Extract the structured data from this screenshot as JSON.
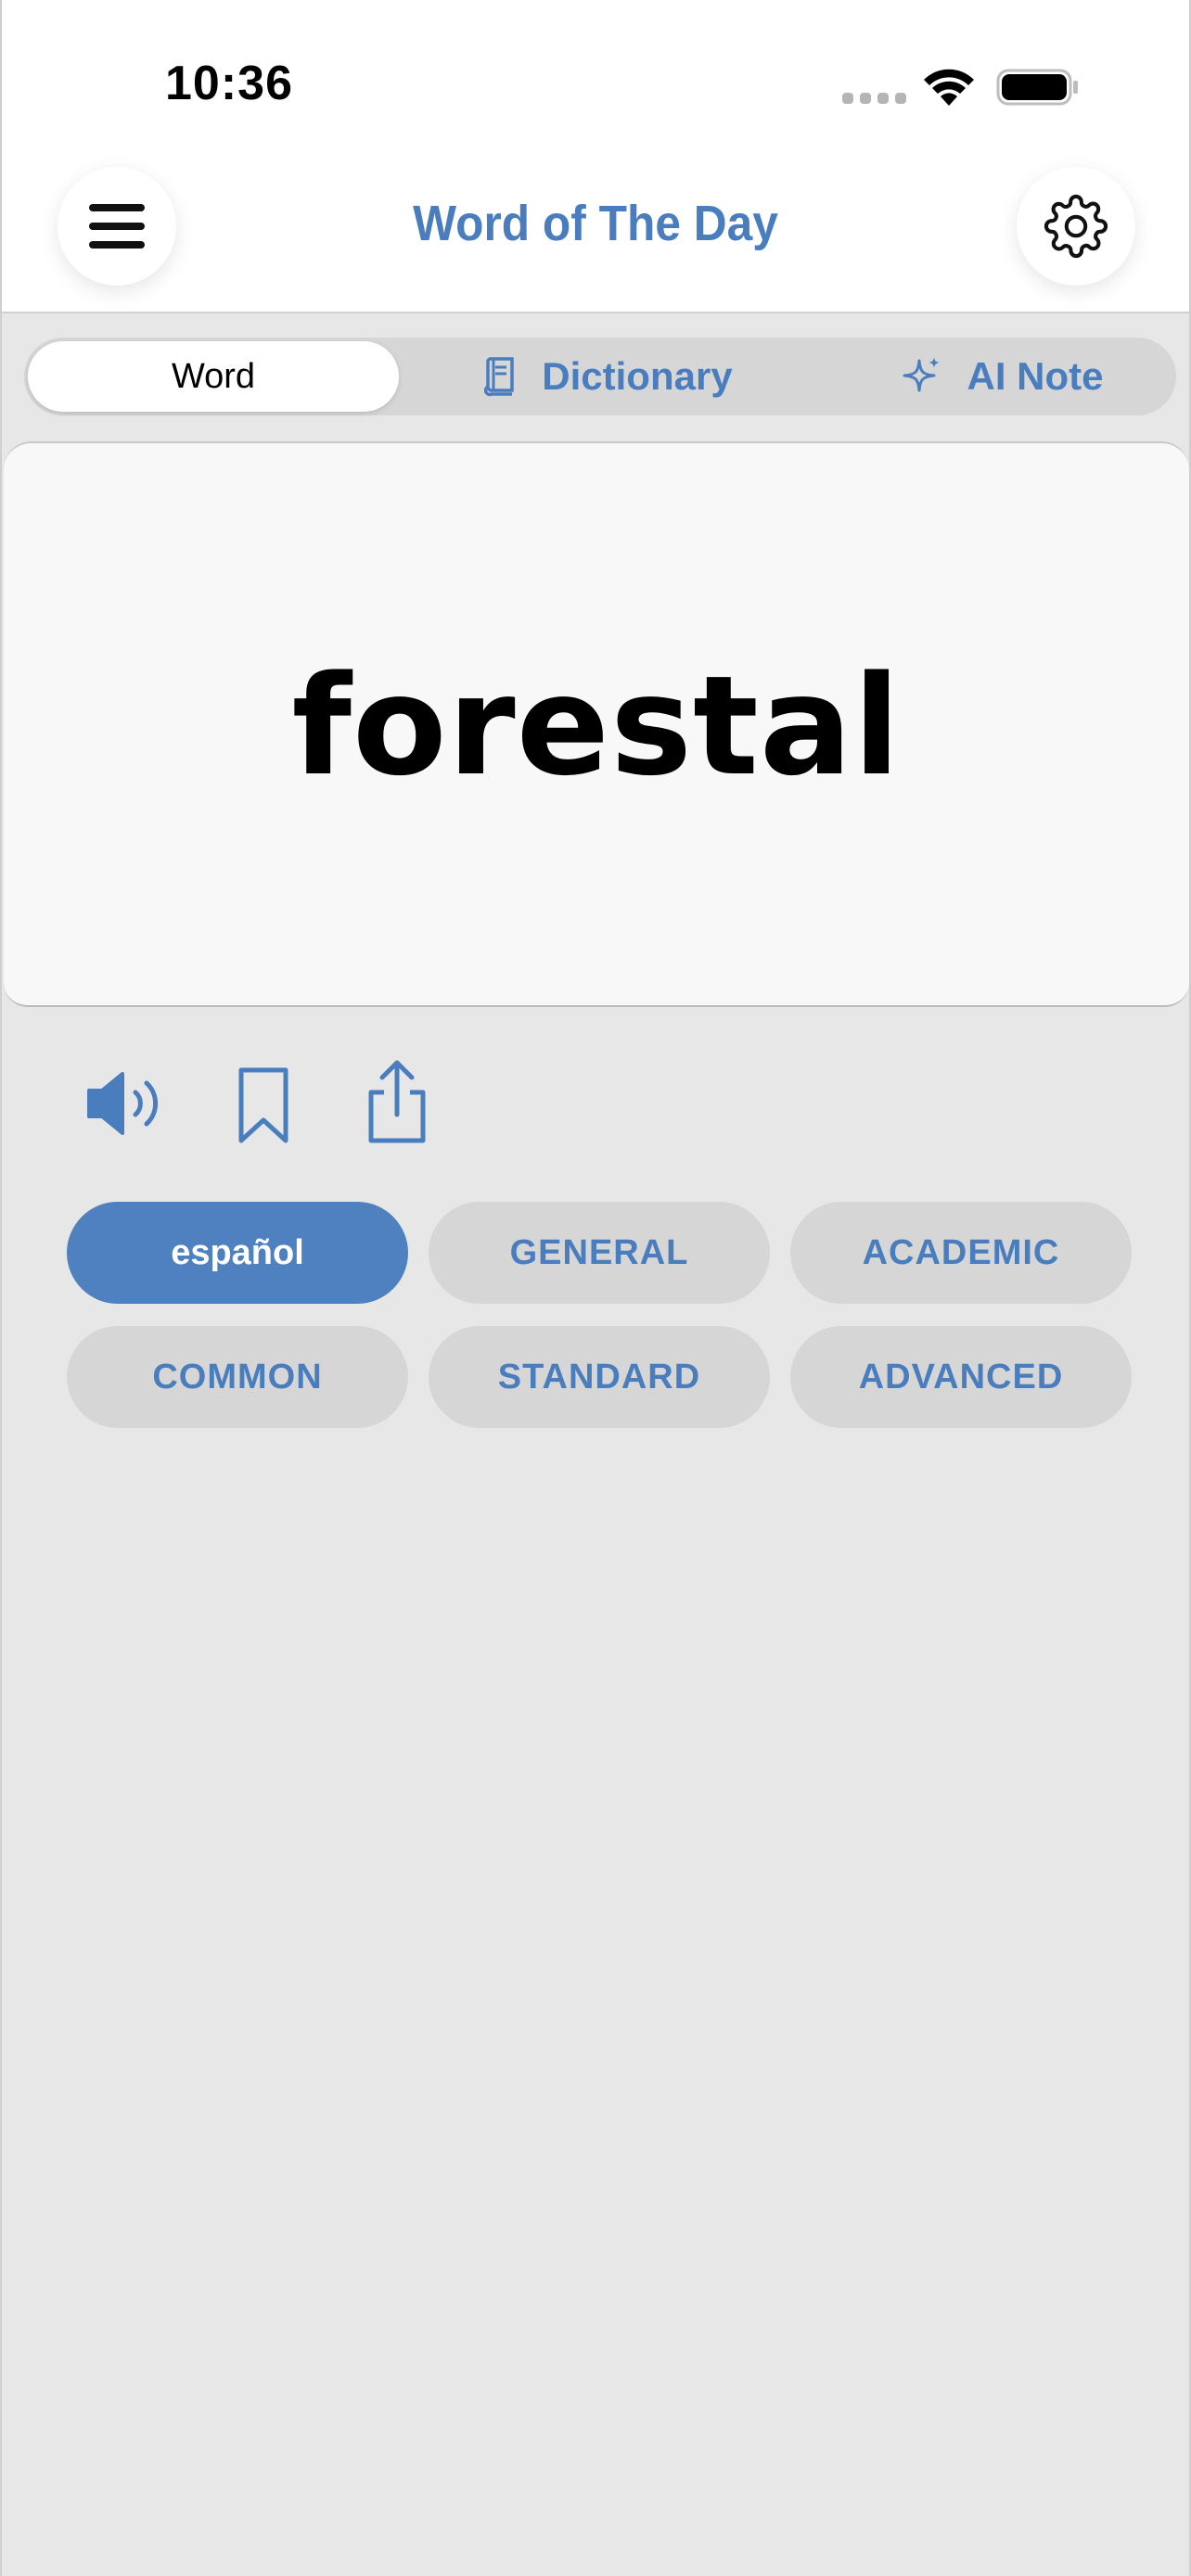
{
  "status_bar": {
    "time": "10:36"
  },
  "header": {
    "title": "Word of The Day"
  },
  "tabs": [
    {
      "label": "Word",
      "active": true
    },
    {
      "label": "Dictionary",
      "active": false
    },
    {
      "label": "AI Note",
      "active": false
    }
  ],
  "word_card": {
    "word": "forestal"
  },
  "tags": [
    {
      "label": "español",
      "selected": true
    },
    {
      "label": "GENERAL",
      "selected": false
    },
    {
      "label": "ACADEMIC",
      "selected": false
    },
    {
      "label": "COMMON",
      "selected": false
    },
    {
      "label": "STANDARD",
      "selected": false
    },
    {
      "label": "ADVANCED",
      "selected": false
    }
  ],
  "icons": {
    "menu": "hamburger-menu-icon",
    "settings": "gear-icon",
    "dictionary": "book-icon",
    "ai_note": "sparkle-icon",
    "speaker": "speaker-icon",
    "bookmark": "bookmark-icon",
    "share": "share-icon"
  },
  "colors": {
    "accent": "#4a7dbe",
    "selected_chip": "#4f80bf",
    "chip": "#d6d6d6",
    "background": "#e7e7e7"
  }
}
